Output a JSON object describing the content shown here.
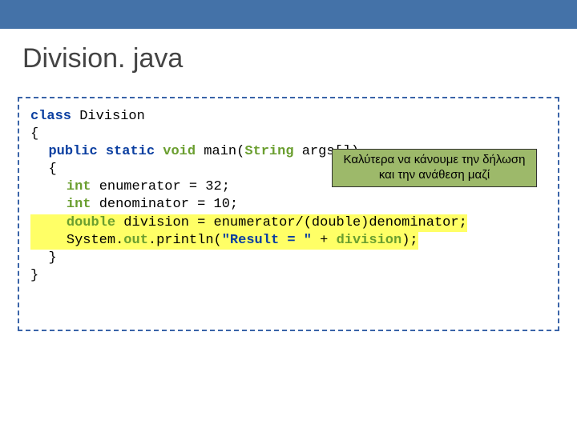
{
  "title": "Division. java",
  "code": {
    "l1_kw": "class ",
    "l1_rest": "Division",
    "l2": "{",
    "l3_kw1": "public ",
    "l3_kw2": "static ",
    "l3_type1": "void ",
    "l3_main": "main(",
    "l3_type2": "String ",
    "l3_rest": "args[])",
    "l4": "{",
    "l5_type": "int ",
    "l5_rest": "enumerator = 32;",
    "l6_type": "int ",
    "l6_rest": "denominator = 10;",
    "l7_type": "double ",
    "l7_rest": "division = enumerator/(double)denominator;",
    "l8_pre": "System.",
    "l8_out": "out",
    "l8_print": ".println(",
    "l8_str": "\"Result = \" ",
    "l8_plus": "+ ",
    "l8_var": "division",
    "l8_end": ");",
    "l9": "}",
    "l10": "}"
  },
  "callout": {
    "line1": "Καλύτερα να κάνουμε την δήλωση",
    "line2": "και την ανάθεση μαζί"
  }
}
